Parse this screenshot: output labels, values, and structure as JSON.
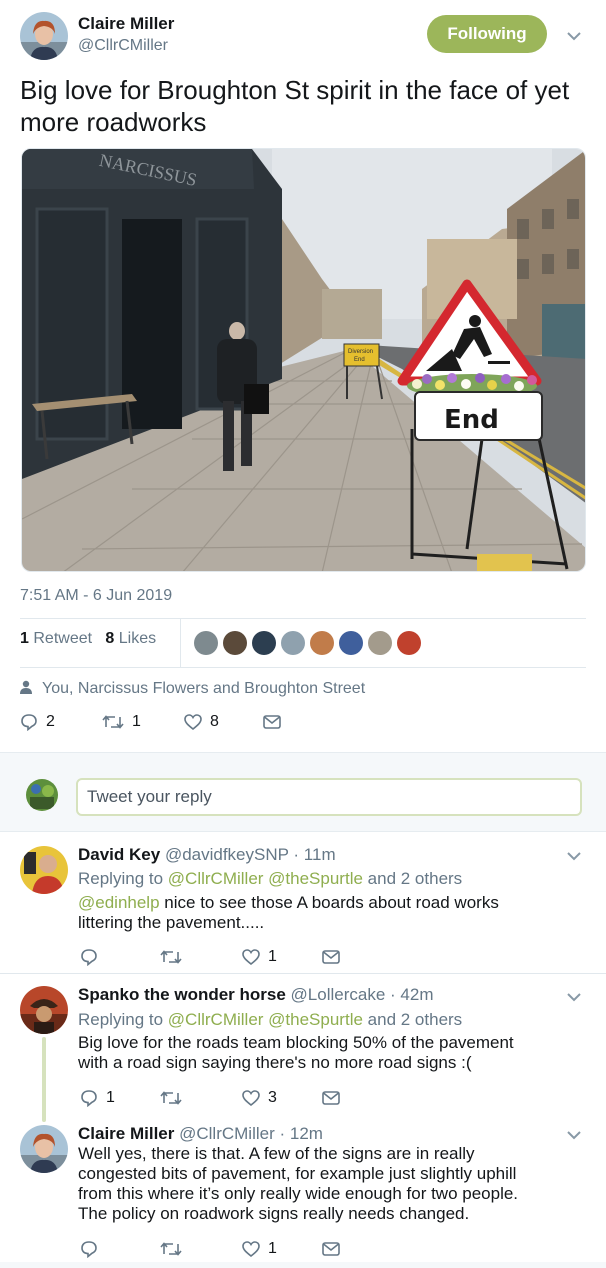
{
  "tweet": {
    "author_name": "Claire Miller",
    "author_handle": "@CllrCMiller",
    "follow_label": "Following",
    "text": "Big love for Broughton St spirit in the face of yet more roadworks",
    "image": {
      "shop_sign": "NARCISSUS",
      "sign_label": "End",
      "small_sign_line1": "Diversion",
      "small_sign_line2": "End"
    },
    "timestamp": "7:51 AM - 6 Jun 2019",
    "retweet_count": "1",
    "retweet_label": "Retweet",
    "like_count": "8",
    "like_label": "Likes",
    "liked_by": "You, Narcissus Flowers and Broughton Street",
    "actions": {
      "replies": "2",
      "retweets": "1",
      "likes": "8"
    }
  },
  "reply_box": {
    "placeholder": "Tweet your reply"
  },
  "replies": [
    {
      "name": "David Key",
      "handle": "@davidfkeySNP",
      "time": "· 11m",
      "replying_prefix": "Replying to",
      "replying_to_1": "@CllrCMiller",
      "replying_to_2": "@theSpurtle",
      "replying_suffix": "and 2 others",
      "mention": "@edinhelp",
      "text_line1": "nice to see those A boards about road works",
      "text_line2": "littering the pavement.....",
      "reply_count": "",
      "retweet_count": "",
      "like_count": "1"
    },
    {
      "name": "Spanko the wonder horse",
      "handle": "@Lollercake",
      "time": "· 42m",
      "replying_prefix": "Replying to",
      "replying_to_1": "@CllrCMiller",
      "replying_to_2": "@theSpurtle",
      "replying_suffix": "and 2 others",
      "text_line1": "Big love for the roads team blocking 50% of the pavement",
      "text_line2": "with a road sign saying there's no more road signs :(",
      "reply_count": "1",
      "retweet_count": "",
      "like_count": "3"
    },
    {
      "name": "Claire Miller",
      "handle": "@CllrCMiller",
      "time": "· 12m",
      "text_line1": "Well yes, there is that. A few of the signs are in really",
      "text_line2": "congested bits of pavement, for example just slightly uphill",
      "text_line3": "from this where it’s only really wide enough for two people.",
      "text_line4": "The policy on roadwork signs really needs changed.",
      "reply_count": "",
      "retweet_count": "",
      "like_count": "1"
    }
  ],
  "colors": {
    "accent": "#9cb65a",
    "link": "#8fae4f",
    "muted": "#657786",
    "text": "#14171a",
    "border": "#e1e8ed"
  },
  "icons": [
    "chevron-down-icon",
    "person-icon",
    "reply-icon",
    "retweet-icon",
    "heart-icon",
    "message-icon"
  ]
}
